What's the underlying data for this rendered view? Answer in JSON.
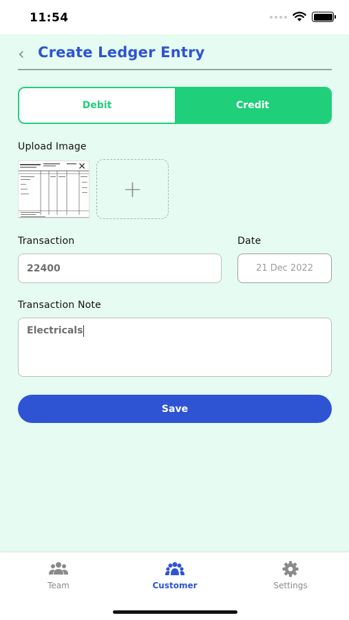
{
  "status_bar": {
    "time": "11:54"
  },
  "header": {
    "title": "Create Ledger Entry"
  },
  "toggle": {
    "debit_label": "Debit",
    "credit_label": "Credit",
    "selected": "Credit"
  },
  "form": {
    "upload_label": "Upload Image",
    "transaction_label": "Transaction",
    "transaction_value": "22400",
    "date_label": "Date",
    "date_value": "21 Dec 2022",
    "note_label": "Transaction Note",
    "note_value": "Electricals",
    "save_label": "Save"
  },
  "tabs": [
    {
      "label": "Team",
      "icon": "team-icon",
      "active": false
    },
    {
      "label": "Customer",
      "icon": "customer-icon",
      "active": true
    },
    {
      "label": "Settings",
      "icon": "gear-icon",
      "active": false
    }
  ],
  "colors": {
    "accent_blue": "#2f54d3",
    "accent_green": "#1fcf7a",
    "background": "#e6fbf1"
  }
}
